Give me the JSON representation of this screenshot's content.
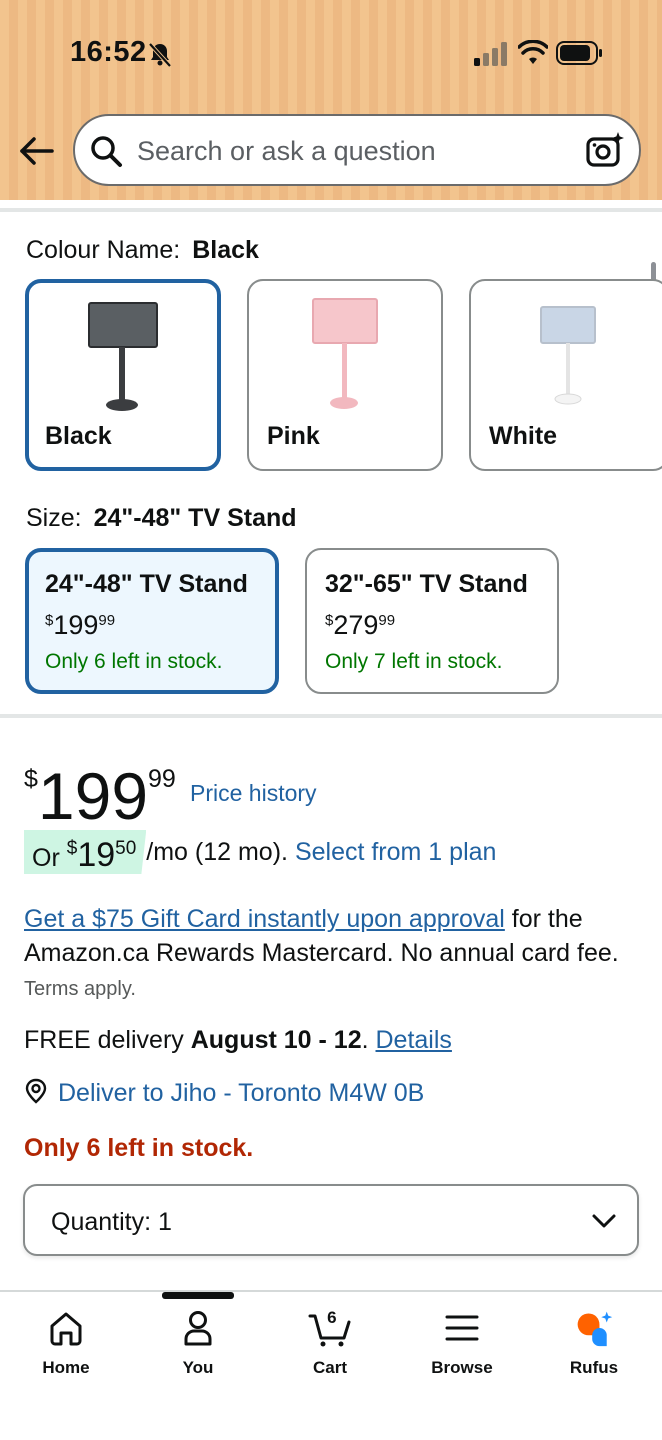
{
  "status_bar": {
    "time": "16:52"
  },
  "search": {
    "placeholder": "Search or ask a question"
  },
  "colour": {
    "heading_label": "Colour Name:",
    "selected_value": "Black",
    "swatches": [
      {
        "label": "Black",
        "screen_color": "#5a5f63",
        "base_color": "#3b3d40"
      },
      {
        "label": "Pink",
        "screen_color": "#f6c6cb",
        "base_color": "#f2b8bf"
      },
      {
        "label": "White",
        "screen_color": "#c9d6e6",
        "base_color": "#f4f4f4"
      }
    ]
  },
  "size": {
    "heading_label": "Size:",
    "selected_value": "24\"-48\" TV Stand",
    "options": [
      {
        "title": "24\"-48\" TV Stand",
        "currency": "$",
        "dollars": "199",
        "cents": "99",
        "stock": "Only 6 left in stock."
      },
      {
        "title": "32\"-65\" TV Stand",
        "currency": "$",
        "dollars": "279",
        "cents": "99",
        "stock": "Only 7 left in stock."
      }
    ]
  },
  "price": {
    "currency": "$",
    "dollars": "199",
    "cents": "99",
    "history_link": "Price history"
  },
  "installment": {
    "prefix": "Or",
    "currency": "$",
    "dollars": "19",
    "cents": "50",
    "suffix": "/mo (12 mo).",
    "link": "Select from 1 plan"
  },
  "offer": {
    "link": "Get a $75 Gift Card instantly upon approval",
    "text": " for the Amazon.ca Rewards Mastercard. No annual card fee.",
    "terms": "Terms apply."
  },
  "delivery": {
    "prefix": "FREE delivery ",
    "dates": "August 10 - 12",
    "separator": ". ",
    "details_link": "Details"
  },
  "deliver_to": "Deliver to Jiho - Toronto M4W 0B",
  "stock_warning": "Only 6 left in stock.",
  "quantity": {
    "label": "Quantity:",
    "value": "1"
  },
  "bottom_nav": {
    "items": [
      {
        "label": "Home",
        "icon": "home-icon"
      },
      {
        "label": "You",
        "icon": "person-icon"
      },
      {
        "label": "Cart",
        "icon": "cart-icon"
      },
      {
        "label": "Browse",
        "icon": "menu-icon"
      },
      {
        "label": "Rufus",
        "icon": "rufus-icon"
      }
    ],
    "cart_count": "6"
  },
  "colors": {
    "header_bg": "#f2c48e",
    "selected_border": "#2162a1",
    "link": "#2162a1",
    "in_stock_green": "#007600",
    "warning_red": "#b12704",
    "installment_bg": "#cef5e3"
  }
}
